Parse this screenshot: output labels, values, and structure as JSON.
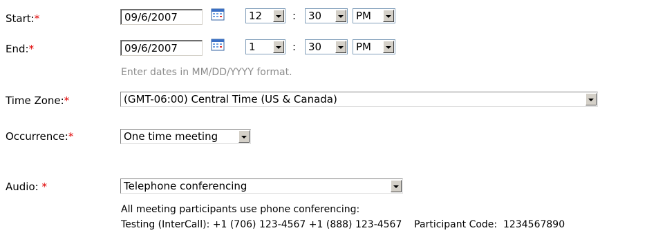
{
  "start": {
    "label": "Start:",
    "required_mark": "*",
    "date": "09/6/2007",
    "hour": "12",
    "minute": "30",
    "ampm": "PM",
    "separator": ":"
  },
  "end": {
    "label": "End:",
    "required_mark": "*",
    "date": "09/6/2007",
    "hour": "1",
    "minute": "30",
    "ampm": "PM",
    "separator": ":"
  },
  "date_hint": "Enter dates in MM/DD/YYYY format.",
  "timezone": {
    "label": "Time Zone:",
    "required_mark": "*",
    "value": "(GMT-06:00) Central Time (US & Canada)"
  },
  "occurrence": {
    "label": "Occurrence:",
    "required_mark": "*",
    "value": "One time meeting"
  },
  "audio": {
    "label": "Audio: ",
    "required_mark": "*",
    "value": "Telephone conferencing",
    "info_line1": "All meeting participants use phone conferencing:",
    "info_line2": "Testing (InterCall): +1 (706) 123-4567 +1 (888) 123-4567    Participant Code:  1234567890"
  },
  "icons": {
    "calendar": "calendar-icon",
    "dropdown": "chevron-down-icon"
  },
  "colors": {
    "required": "#e00000",
    "hint": "#8c8c8c",
    "button_face": "#d4d0c8"
  }
}
